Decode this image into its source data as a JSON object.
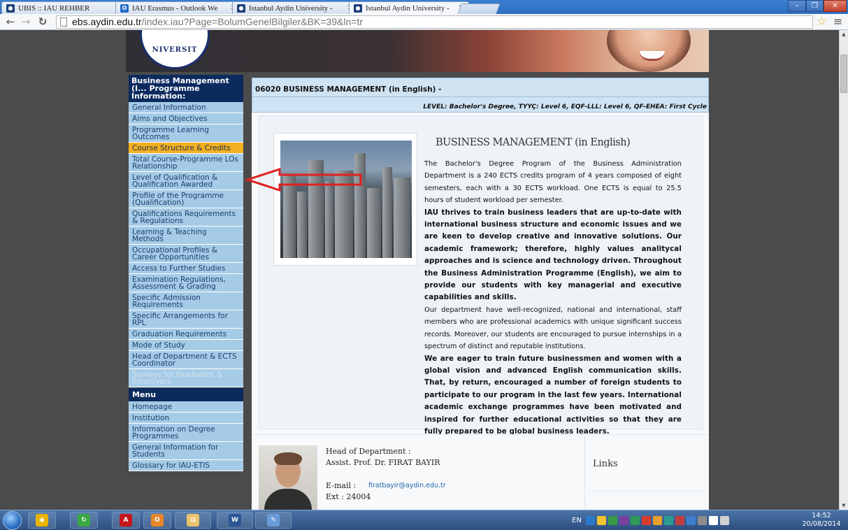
{
  "browser": {
    "tabs": [
      {
        "label": "UBIS :: IAU REHBER",
        "favicon_color": "#1c3f7a",
        "favicon_glyph": "●"
      },
      {
        "label": "IAU Erasmus - Outlook We",
        "favicon_color": "#1f6cc4",
        "favicon_glyph": "O"
      },
      {
        "label": "Istanbul Aydin University -",
        "favicon_color": "#1c3f7a",
        "favicon_glyph": "●"
      },
      {
        "label": "Istanbul Aydin University -",
        "favicon_color": "#1c3f7a",
        "favicon_glyph": "●"
      }
    ],
    "url_host": "ebs.aydin.edu.tr",
    "url_path": "/index.iau?Page=BolumGenelBilgiler&BK=39&ln=tr",
    "icons": {
      "back": "back-arrow-icon",
      "forward": "forward-arrow-icon",
      "reload": "reload-icon",
      "bookmark": "star-icon",
      "menu": "hamburger-menu-icon"
    }
  },
  "banner": {
    "seal_text": "NIVERSIT"
  },
  "sidebar": {
    "header": "Business Management (I... Programme Information:",
    "items": [
      "General Information",
      "Aims and Objectives",
      "Programme Learning Outcomes",
      "Course Structure & Credits",
      "Total Course-Programme LOs Relationship",
      "Level of Qualification & Qualification Awarded",
      "Profile of the Programme (Qualification)",
      "Qualifications Requirements & Regulations",
      "Learning & Teaching Methods",
      "Occupational Profiles & Career Opportunities",
      "Access to Further Studies",
      "Examination Regulations, Assessment & Grading",
      "Specific Admission Requirements",
      "Specific Arrangements for RPL",
      "Graduation Requirements",
      "Mode of Study",
      "Head of Department & ECTS Coordinator",
      "Surveys for Graduates & Employers"
    ],
    "active_item": "Course Structure & Credits",
    "menu_header": "Menu",
    "menu_items": [
      "Homepage",
      "Institution",
      "Information on Degree Programmes",
      "General Information for Students",
      "Glossary for IAU-ETIS"
    ]
  },
  "programme": {
    "title": "06020 BUSINESS MANAGEMENT (in English) -",
    "level": "LEVEL: Bachelor's Degree, TYYÇ: Level 6, EQF-LLL: Level 6, QF-EHEA: First Cycle"
  },
  "content": {
    "heading": "BUSINESS MANAGEMENT (in English)",
    "paragraphs": [
      {
        "bold": false,
        "text": "The Bachelor's Degree Program of the Business Administration Department is a 240 ECTS credits program of 4 years composed of eight semesters, each with a 30 ECTS workload. One ECTS is equal to 25.5 hours of student workload per semester."
      },
      {
        "bold": true,
        "text": "IAU thrives to train business leaders that are up-to-date with international business structure and economic issues and we are keen to develop creative and innovative solutions. Our academic framework; therefore, highly values analitycal approaches and is science and technology driven. Throughout the Business Administration Programme (English), we aim to provide our students with key managerial and executive capabilities and skills."
      },
      {
        "bold": false,
        "text": "Our department have well-recognized, national and international, staff members who are professional academics with unique significant success records. Moreover, our students are encouraged to pursue internships in a spectrum of distinct and reputable institutions."
      },
      {
        "bold": true,
        "text": "We are eager to train future businessmen and women with a global vision and advanced English communication skills. That, by return, encouraged a number of foreign students to participate to our program in the last few years. International academic exchange programmes have been motivated and inspired for further educational activities so that they are fully prepared to be global business leaders."
      }
    ]
  },
  "head_of_department": {
    "label": "Head of Department :",
    "name": "Assist. Prof. Dr. FIRAT BAYIR",
    "email_label": "E-mail :",
    "email": "firatbayir@aydin.edu.tr",
    "ext": "Ext : 24004"
  },
  "links": {
    "title": "Links"
  },
  "annotation": {
    "arrow_color": "#e02020"
  },
  "taskbar": {
    "apps": [
      {
        "name": "chrome-icon",
        "color": "#e8b400",
        "glyph": "◉"
      },
      {
        "name": "refresh-app-icon",
        "color": "#3aa845",
        "glyph": "↻"
      },
      {
        "name": "acrobat-icon",
        "color": "#c4161c",
        "glyph": "A"
      },
      {
        "name": "outlook-icon",
        "color": "#e8862a",
        "glyph": "O"
      },
      {
        "name": "explorer-folder-icon",
        "color": "#e9c36a",
        "glyph": "▤"
      },
      {
        "name": "word-icon",
        "color": "#2b5797",
        "glyph": "W"
      },
      {
        "name": "paint-icon",
        "color": "#6a9bd8",
        "glyph": "✎"
      }
    ],
    "lang": "EN",
    "tray_colors": [
      "#2a78c9",
      "#f2c230",
      "#3b9a46",
      "#7a3fa0",
      "#2e9b54",
      "#d93c2c",
      "#e8a02a",
      "#2a9d8f",
      "#c43d3d",
      "#3f7fd0",
      "#8c8c8c",
      "#ffffff",
      "#d0d0d0"
    ],
    "time": "14:52",
    "date": "20/08/2014"
  }
}
